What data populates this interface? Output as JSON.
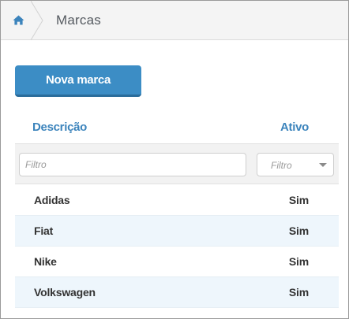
{
  "breadcrumb": {
    "home_icon": "home-icon",
    "title": "Marcas"
  },
  "toolbar": {
    "new_label": "Nova marca"
  },
  "table": {
    "columns": {
      "descricao": "Descrição",
      "ativo": "Ativo"
    },
    "filters": {
      "descricao_placeholder": "Filtro",
      "ativo_placeholder": "Filtro"
    },
    "rows": [
      {
        "descricao": "Adidas",
        "ativo": "Sim"
      },
      {
        "descricao": "Fiat",
        "ativo": "Sim"
      },
      {
        "descricao": "Nike",
        "ativo": "Sim"
      },
      {
        "descricao": "Volkswagen",
        "ativo": "Sim"
      }
    ]
  },
  "colors": {
    "accent": "#3c8dc5",
    "header_text": "#3c84bc",
    "row_alt": "#eef6fc"
  }
}
